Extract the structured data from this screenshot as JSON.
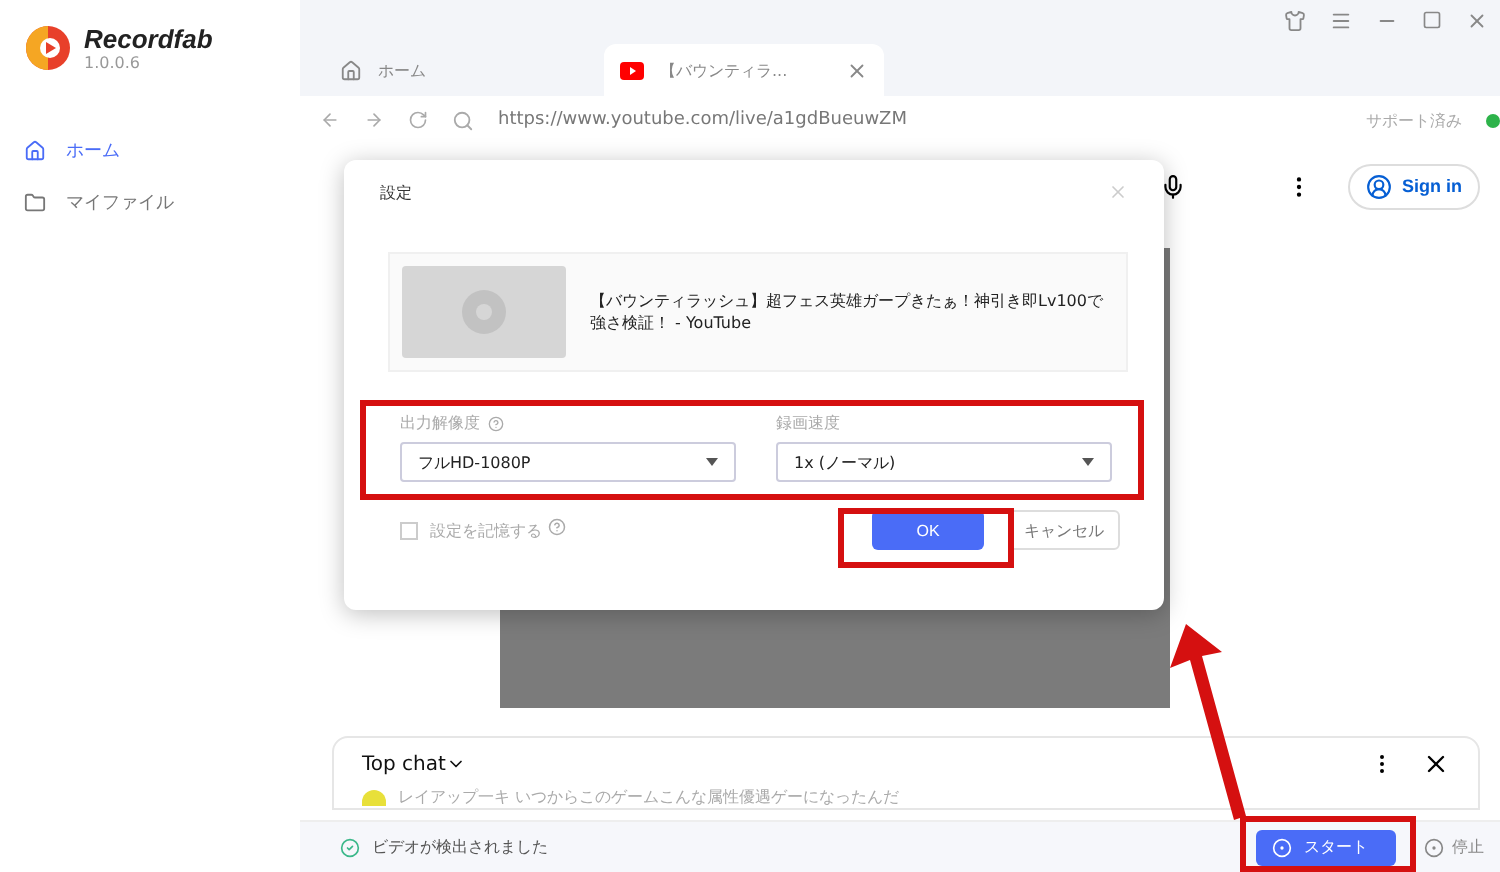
{
  "app": {
    "name": "Recordfab",
    "version": "1.0.0.6"
  },
  "sidebar": {
    "items": [
      {
        "label": "ホーム",
        "selected": true
      },
      {
        "label": "マイファイル",
        "selected": false
      }
    ]
  },
  "tabs": [
    {
      "label": "ホーム",
      "selected": false
    },
    {
      "label": "【バウンティラ...",
      "selected": true
    }
  ],
  "address_bar": {
    "url": "https://www.youtube.com/live/a1gdBueuwZM",
    "status": "サポート済み"
  },
  "page": {
    "sign_in": "Sign in"
  },
  "dialog": {
    "title": "設定",
    "video_title": "【バウンティラッシュ】超フェス英雄ガープきたぁ！神引き即Lv100で強さ検証！ - YouTube",
    "resolution": {
      "label": "出力解像度",
      "value": "フルHD-1080P"
    },
    "speed": {
      "label": "録画速度",
      "value": "1x (ノーマル)"
    },
    "remember": {
      "label": "設定を記憶する",
      "checked": false
    },
    "buttons": [
      {
        "label": "OK",
        "kind": "primary"
      },
      {
        "label": "キャンセル",
        "kind": "secondary"
      }
    ]
  },
  "chat": {
    "title": "Top chat",
    "message": "レイアップ一キ いつからこのゲームこんな属性優遇ゲーになったんだ"
  },
  "status_bar": {
    "message": "ビデオが検出されました",
    "start": "スタート",
    "stop": "停止"
  }
}
